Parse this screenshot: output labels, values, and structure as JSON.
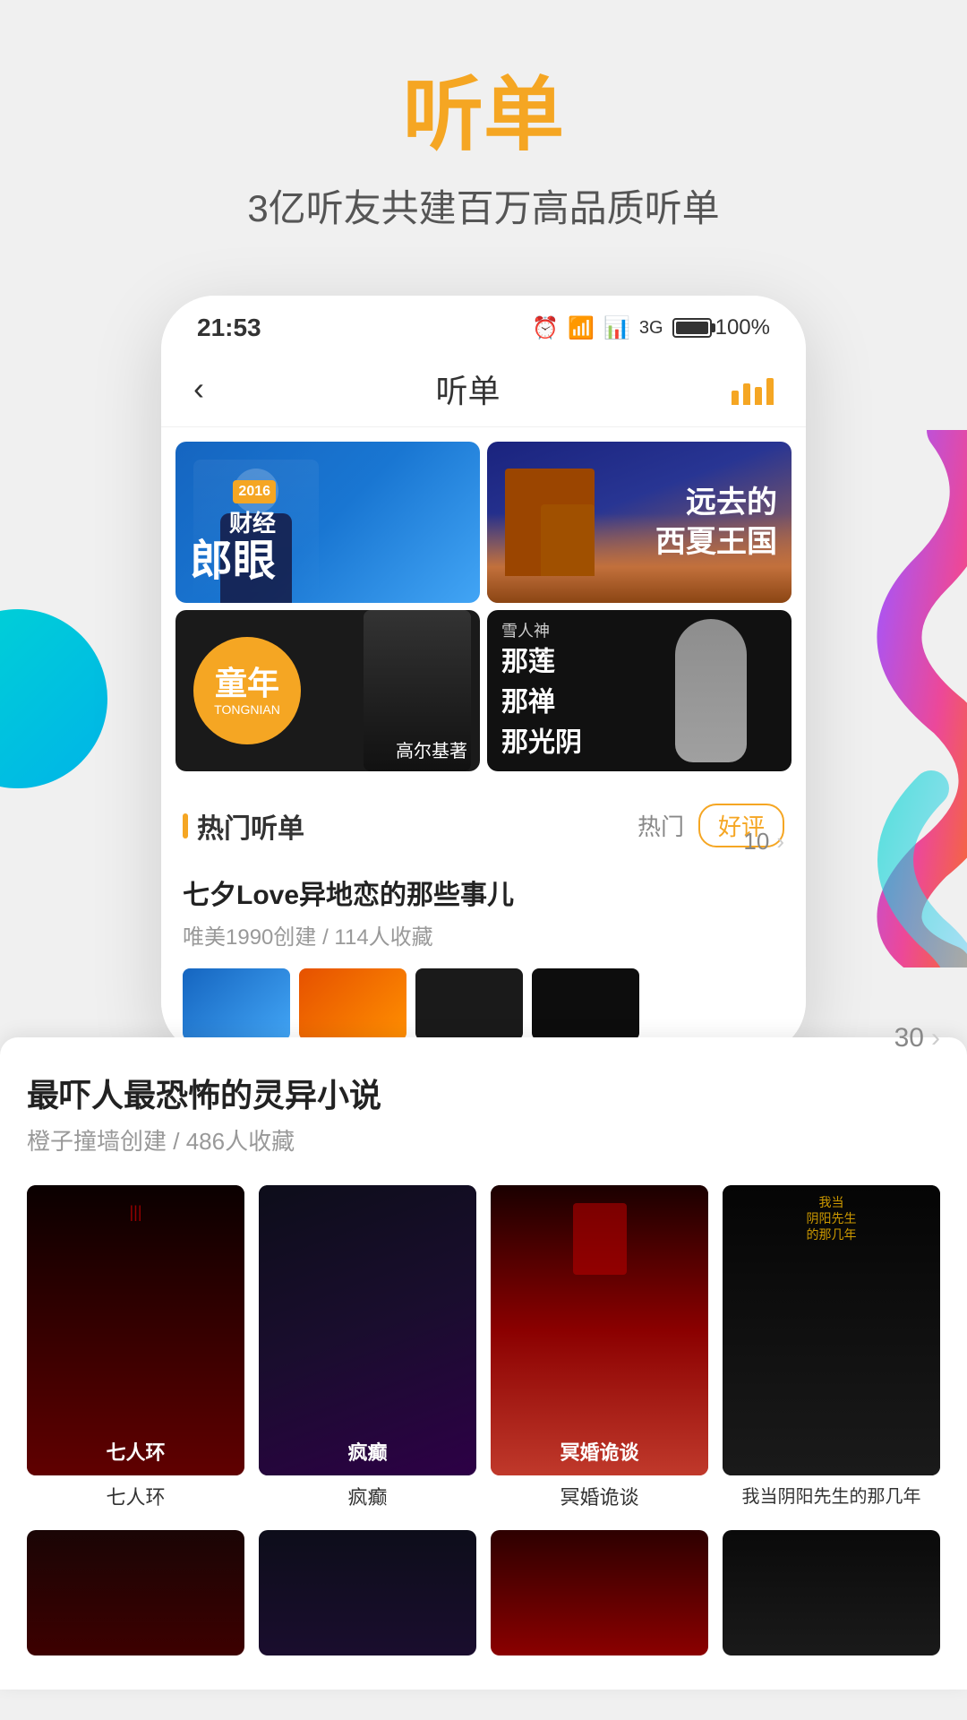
{
  "page": {
    "title": "听单",
    "subtitle": "3亿听友共建百万高品质听单",
    "background_color": "#f0f0f0"
  },
  "status_bar": {
    "time": "21:53",
    "battery_percent": "100%",
    "icons": [
      "alarm",
      "wifi",
      "signal",
      "battery"
    ]
  },
  "navbar": {
    "back_label": "<",
    "title": "听单",
    "chart_icon": "bar-chart"
  },
  "banners": [
    {
      "id": "banner-1",
      "badge": "2016",
      "title": "财经郎眼",
      "style": "blue"
    },
    {
      "id": "banner-2",
      "title": "远去的\n西夏王国",
      "style": "desert"
    },
    {
      "id": "banner-3",
      "title": "童年",
      "subtitle": "TONGNIAN",
      "author": "高尔基著",
      "style": "dark"
    },
    {
      "id": "banner-4",
      "line1": "那莲",
      "line2": "那禅",
      "line3": "那光阴",
      "style": "black"
    }
  ],
  "section": {
    "title": "热门听单",
    "filter_hot": "热门",
    "filter_review": "好评"
  },
  "playlist_1": {
    "title": "七夕Love异地恋的那些事儿",
    "creator": "唯美1990创建",
    "favorites": "114人收藏",
    "count": "10"
  },
  "playlist_2": {
    "title": "最吓人最恐怖的灵异小说",
    "creator": "橙子撞墙创建",
    "favorites": "486人收藏",
    "count": "30"
  },
  "books": [
    {
      "id": "book-1",
      "title": "七人环",
      "cover_overlay": "七人环"
    },
    {
      "id": "book-2",
      "title": "疯癫",
      "cover_overlay": "疯癫"
    },
    {
      "id": "book-3",
      "title": "冥婚诡谈",
      "cover_overlay": "冥婚诡谈"
    },
    {
      "id": "book-4",
      "title": "我当阴阳先生的那几年",
      "cover_overlay": "我当阴阳先生的那几年"
    }
  ],
  "more_books": [
    {
      "id": "more-book-1",
      "cover_style": "dark-red"
    },
    {
      "id": "more-book-2",
      "cover_style": "dark-blue"
    },
    {
      "id": "more-book-3",
      "cover_style": "dark-red-2"
    },
    {
      "id": "more-book-4",
      "cover_style": "black"
    }
  ]
}
